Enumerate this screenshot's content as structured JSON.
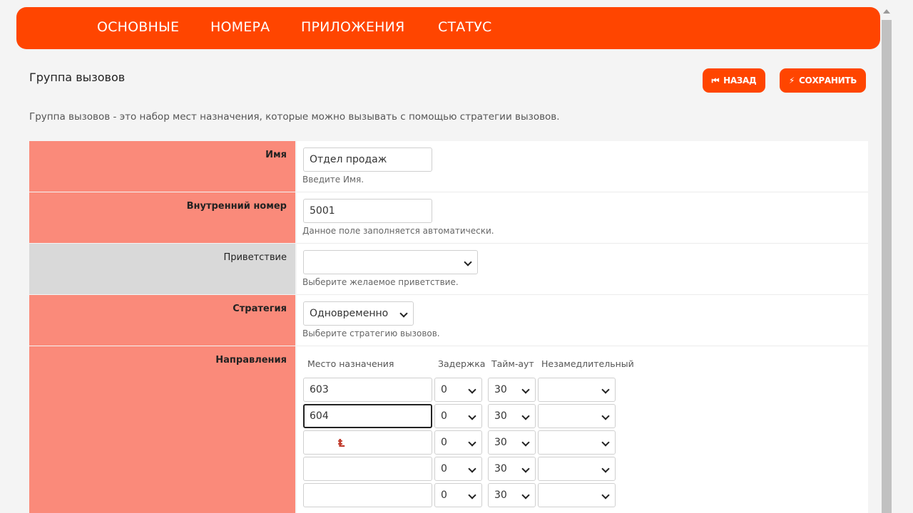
{
  "nav": {
    "items": [
      {
        "label": "ОСНОВНЫЕ"
      },
      {
        "label": "НОМЕРА"
      },
      {
        "label": "ПРИЛОЖЕНИЯ"
      },
      {
        "label": "СТАТУС"
      }
    ]
  },
  "header": {
    "title": "Группа вызовов",
    "back_label": "НАЗАД",
    "save_label": "СОХРАНИТЬ"
  },
  "description": "Группа вызовов - это набор мест назначения, которые можно вызывать с помощью стратегии вызовов.",
  "form": {
    "name": {
      "label": "Имя",
      "value": "Отдел продаж",
      "hint": "Введите Имя."
    },
    "extension": {
      "label": "Внутренний номер",
      "value": "5001",
      "hint": "Данное поле заполняется автоматически."
    },
    "greeting": {
      "label": "Приветствие",
      "value": "",
      "hint": "Выберите желаемое приветствие."
    },
    "strategy": {
      "label": "Стратегия",
      "value": "Одновременно",
      "hint": "Выберите стратегию вызовов."
    },
    "destinations": {
      "label": "Направления",
      "columns": [
        "Место назначения",
        "Задержка",
        "Тайм-аут",
        "Незамедлительный"
      ],
      "rows": [
        {
          "destination": "603",
          "delay": "0",
          "timeout": "30",
          "immediate": ""
        },
        {
          "destination": "604",
          "delay": "0",
          "timeout": "30",
          "immediate": ""
        },
        {
          "destination": "",
          "delay": "0",
          "timeout": "30",
          "immediate": ""
        },
        {
          "destination": "",
          "delay": "0",
          "timeout": "30",
          "immediate": ""
        },
        {
          "destination": "",
          "delay": "0",
          "timeout": "30",
          "immediate": ""
        }
      ]
    }
  },
  "colors": {
    "accent": "#ff4500",
    "required_label_bg": "#fa8a7a",
    "optional_label_bg": "#d9d9d9"
  },
  "icons": {
    "back": "skip-back-icon",
    "save": "lightning-icon",
    "select": "chevron-down-icon",
    "scroll_up": "arrow-up-icon"
  }
}
